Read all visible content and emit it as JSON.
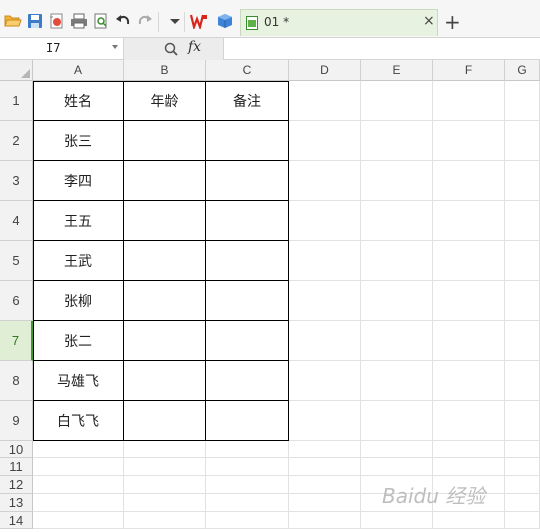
{
  "toolbar": {
    "icons": [
      "folder-open-icon",
      "save-icon",
      "export-pdf-icon",
      "print-icon",
      "print-preview-icon",
      "undo-icon",
      "redo-icon",
      "dropdown-icon",
      "wps-logo-icon",
      "cube-icon"
    ],
    "accent": "#3c9b2c"
  },
  "tab": {
    "title": "01 *",
    "close": "×",
    "new_tab": "+"
  },
  "formula_bar": {
    "cell_ref": "I7",
    "fx": "fx",
    "value": ""
  },
  "columns": [
    "A",
    "B",
    "C",
    "D",
    "E",
    "F",
    "G"
  ],
  "rows": [
    "1",
    "2",
    "3",
    "4",
    "5",
    "6",
    "7",
    "8",
    "9",
    "10",
    "11",
    "12",
    "13",
    "14"
  ],
  "active_row": "7",
  "table": {
    "header": [
      "姓名",
      "年龄",
      "备注"
    ],
    "names": [
      "张三",
      "李四",
      "王五",
      "王武",
      "张柳",
      "张二",
      "马雄飞",
      "白飞飞"
    ]
  },
  "watermark": "Baidu 经验"
}
